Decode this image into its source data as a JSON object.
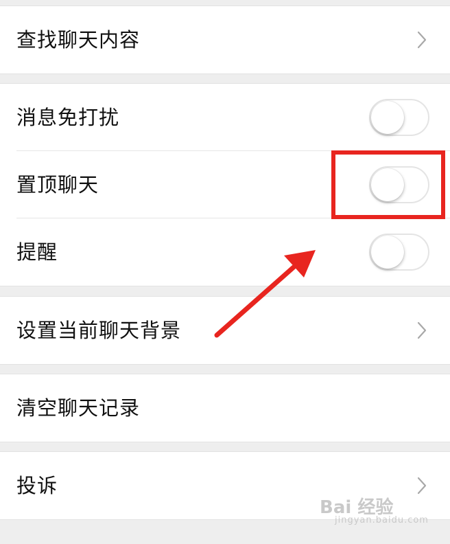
{
  "rows": {
    "search_chat": {
      "label": "查找聊天内容"
    },
    "mute": {
      "label": "消息免打扰",
      "on": false
    },
    "pin": {
      "label": "置顶聊天",
      "on": false
    },
    "remind": {
      "label": "提醒",
      "on": false
    },
    "background": {
      "label": "设置当前聊天背景"
    },
    "clear": {
      "label": "清空聊天记录"
    },
    "report": {
      "label": "投诉"
    }
  },
  "annotation": {
    "highlight_color": "#e8251f",
    "arrow_color": "#e8251f"
  },
  "watermark": {
    "logo": "Bai 经验",
    "sub": "jingyan.baidu.com"
  },
  "colors": {
    "background": "#eeeeee",
    "row": "#ffffff",
    "text": "#111111",
    "chevron": "#a8a8a8"
  }
}
